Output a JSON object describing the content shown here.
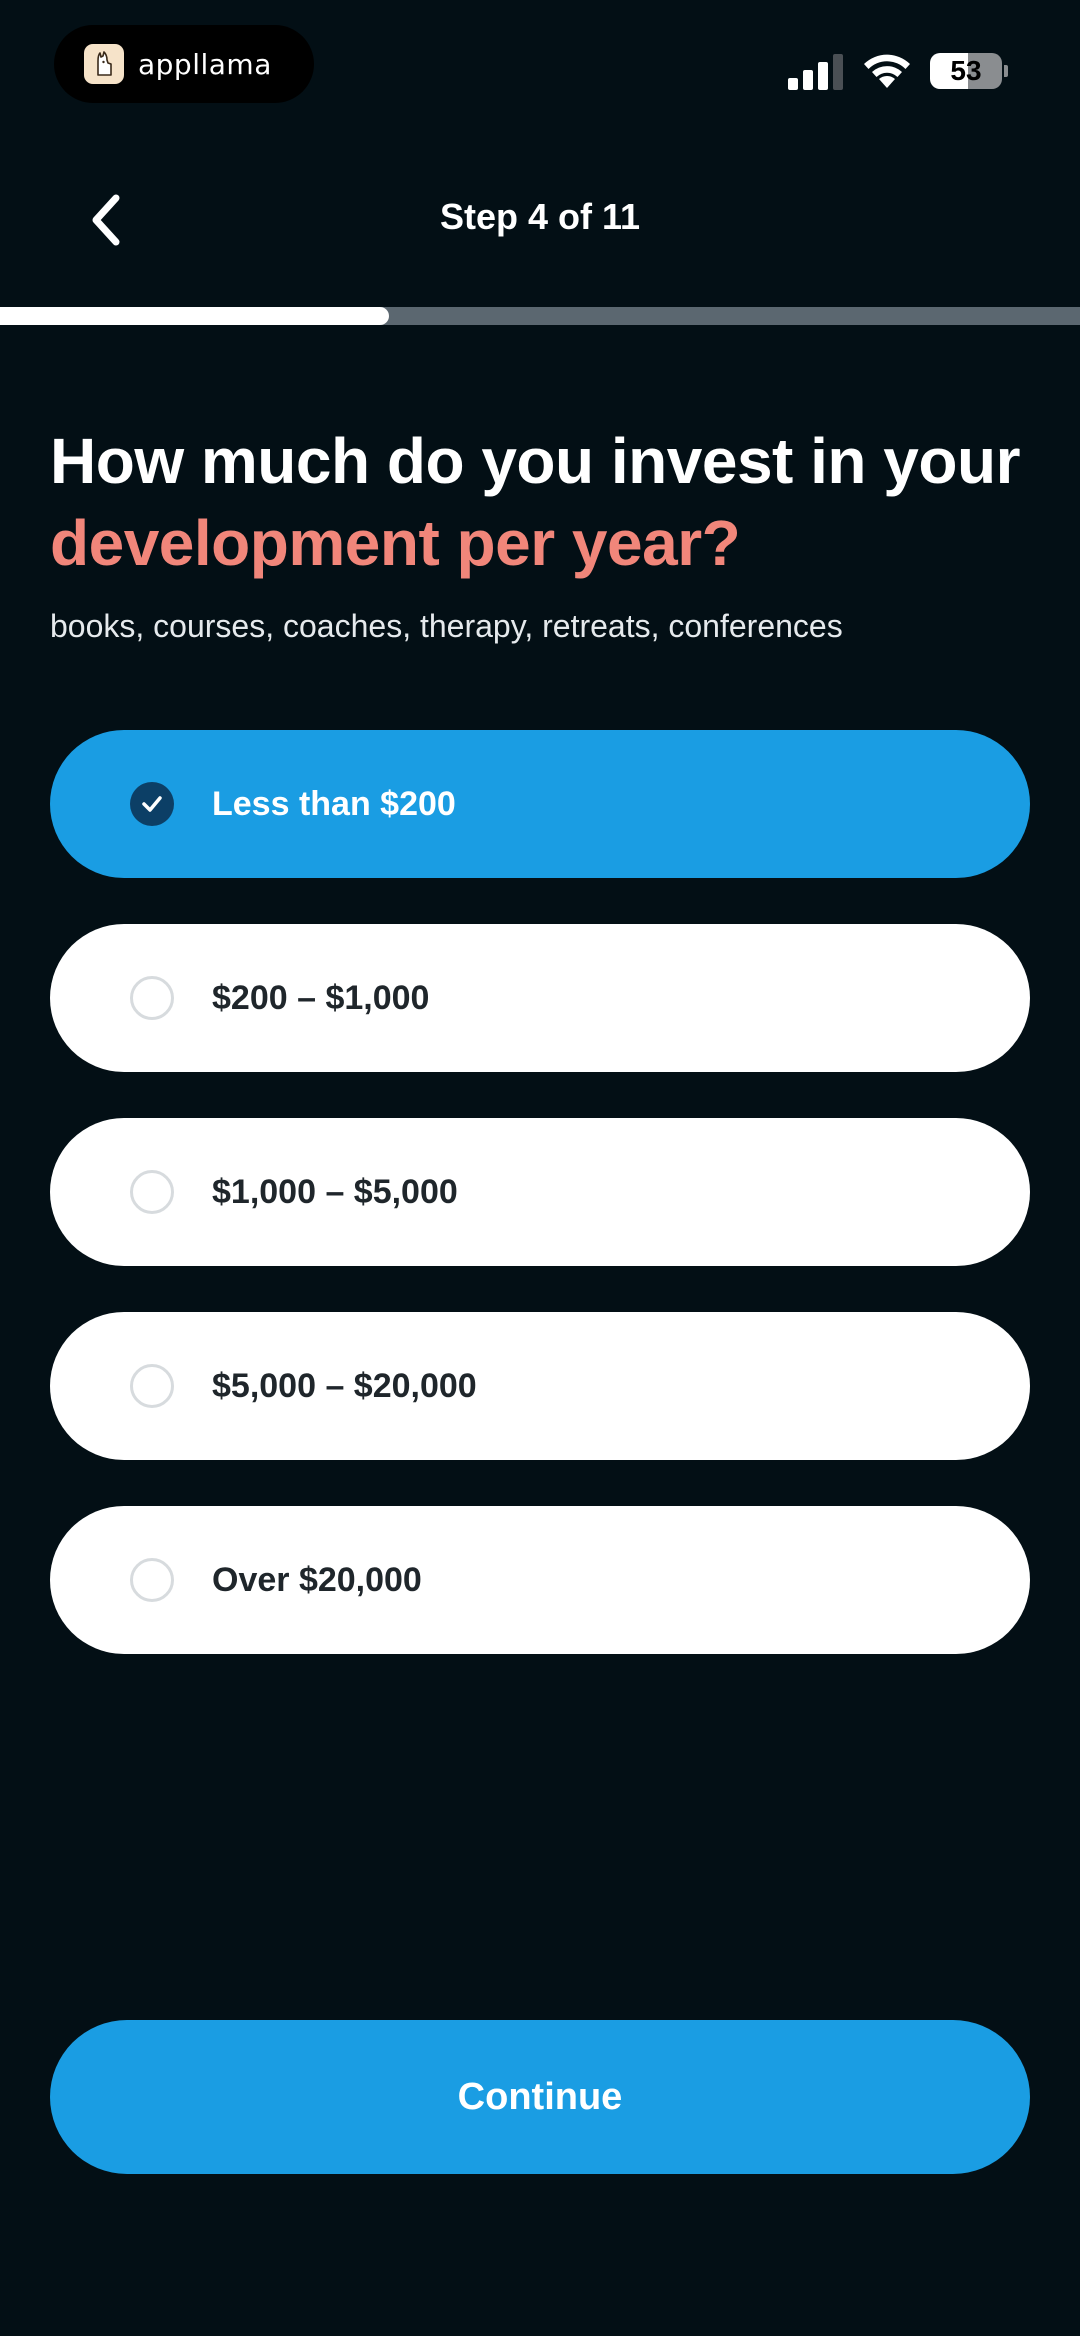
{
  "status_bar": {
    "app_name": "appllama",
    "battery": "53",
    "battery_level": 0.53
  },
  "header": {
    "step_label": "Step 4 of 11",
    "progress": 0.36
  },
  "question": {
    "line1": "How much do you invest in your",
    "line2": "development per year?",
    "subtitle": "books, courses, coaches, therapy, retreats, conferences"
  },
  "options": [
    {
      "label": "Less than $200",
      "selected": true
    },
    {
      "label": "$200 – $1,000",
      "selected": false
    },
    {
      "label": "$1,000 – $5,000",
      "selected": false
    },
    {
      "label": "$5,000 – $20,000",
      "selected": false
    },
    {
      "label": "Over $20,000",
      "selected": false
    }
  ],
  "footer": {
    "continue_label": "Continue"
  },
  "colors": {
    "background": "#030f15",
    "accent": "#1a9de3",
    "highlight": "#f1867a"
  },
  "icons": {
    "back": "chevron-left-icon",
    "check": "check-icon",
    "signal": "cellular-signal-icon",
    "wifi": "wifi-icon",
    "app": "llama-logo-icon"
  }
}
